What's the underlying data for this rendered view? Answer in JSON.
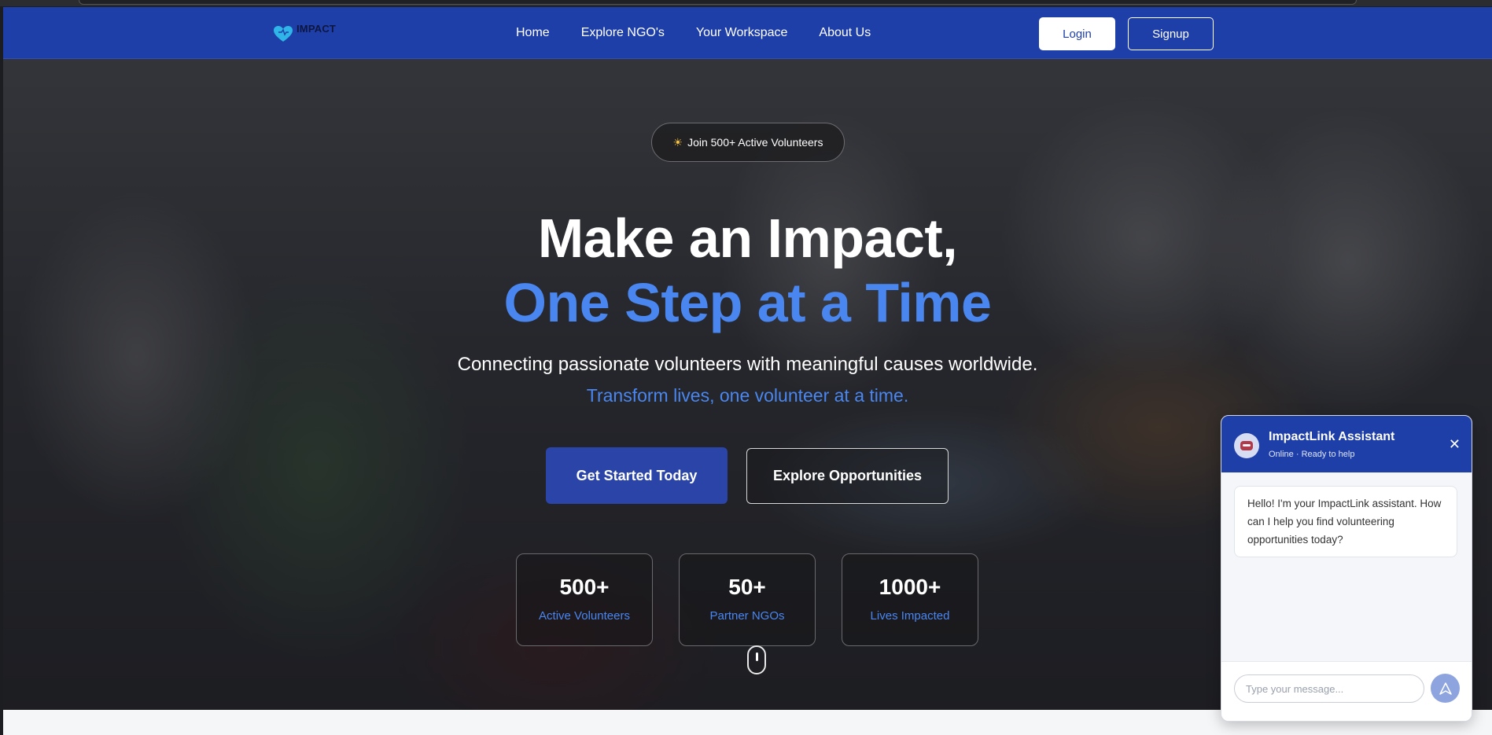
{
  "nav": {
    "logo_text": "IMPACT",
    "links": [
      "Home",
      "Explore NGO's",
      "Your Workspace",
      "About Us"
    ],
    "login_label": "Login",
    "signup_label": "Signup"
  },
  "hero": {
    "badge_text": "Join 500+ Active Volunteers",
    "title_line1": "Make an Impact,",
    "title_line2": "One Step at a Time",
    "subtitle1": "Connecting passionate volunteers with meaningful causes worldwide.",
    "subtitle2": "Transform lives, one volunteer at a time.",
    "primary_cta": "Get Started Today",
    "secondary_cta": "Explore Opportunities",
    "stats": [
      {
        "value": "500+",
        "label": "Active Volunteers"
      },
      {
        "value": "50+",
        "label": "Partner NGOs"
      },
      {
        "value": "1000+",
        "label": "Lives Impacted"
      }
    ]
  },
  "chat": {
    "title": "ImpactLink Assistant",
    "status": "Online · Ready to help",
    "message": "Hello! I'm your ImpactLink assistant. How can I help you find volunteering opportunities today?",
    "input_placeholder": "Type your message..."
  },
  "colors": {
    "nav_bg": "#1f3fa8",
    "accent_blue": "#4a86f0",
    "primary_button": "#2a44a8"
  },
  "icons": [
    "heart-logo-icon",
    "sun-icon",
    "bot-avatar-icon",
    "close-icon",
    "send-icon",
    "mouse-scroll-icon"
  ]
}
